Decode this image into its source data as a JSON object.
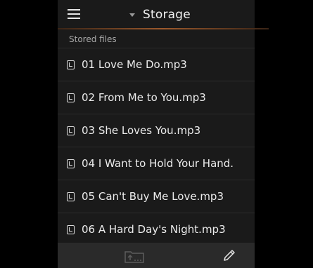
{
  "header": {
    "title": "Storage",
    "menu_icon": "hamburger-menu-icon",
    "dropdown_icon": "caret-down-icon"
  },
  "section": {
    "label": "Stored files"
  },
  "files": [
    {
      "label": "01 Love Me Do.mp3",
      "icon": "audio-file-icon"
    },
    {
      "label": "02 From Me to You.mp3",
      "icon": "audio-file-icon"
    },
    {
      "label": "03 She Loves You.mp3",
      "icon": "audio-file-icon"
    },
    {
      "label": "04 I Want to Hold Your Hand.",
      "icon": "audio-file-icon"
    },
    {
      "label": "05 Can't Buy Me Love.mp3",
      "icon": "audio-file-icon"
    },
    {
      "label": "06 A Hard Day's Night.mp3",
      "icon": "audio-file-icon"
    }
  ],
  "footer": {
    "folder_up_icon": "folder-up-icon",
    "edit_icon": "pencil-icon"
  },
  "colors": {
    "accent": "#9d5a2c",
    "panel": "#1a1a1a",
    "footer": "#2a2a2a"
  }
}
